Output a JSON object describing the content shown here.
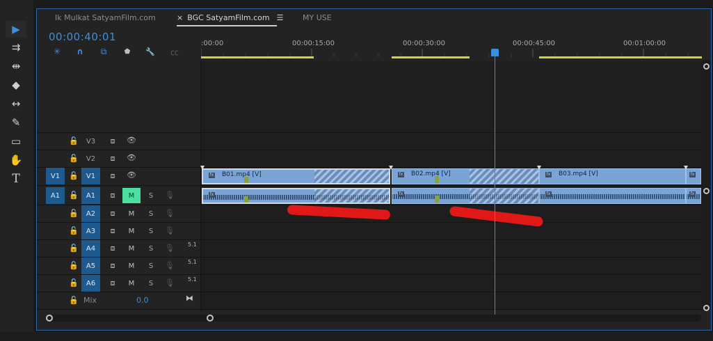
{
  "tabs": [
    {
      "label": "Ik Mulkat SatyamFilm.com",
      "active": false,
      "close": "",
      "menu": ""
    },
    {
      "label": "BGC SatyamFilm.com",
      "active": true,
      "close": "×",
      "menu": "☰"
    },
    {
      "label": "MY USE",
      "active": false,
      "close": "",
      "menu": ""
    }
  ],
  "timecode": "00:00:40:01",
  "ruler": {
    "ticks": [
      ":00:00",
      "00:00:15:00",
      "00:00:30:00",
      "00:00:45:00",
      "00:01:00:00"
    ],
    "playhead_timecode": "00:00:40:01"
  },
  "tools": [
    {
      "name": "selection-tool",
      "icon": "arrow-icon",
      "glyph": "▶",
      "active": true
    },
    {
      "name": "track-select-tool",
      "icon": "track-select-icon",
      "glyph": "⇉",
      "active": false
    },
    {
      "name": "ripple-edit-tool",
      "icon": "ripple-edit-icon",
      "glyph": "⇹",
      "active": false
    },
    {
      "name": "razor-tool",
      "icon": "razor-icon",
      "glyph": "◆",
      "active": false
    },
    {
      "name": "slip-tool",
      "icon": "slip-icon",
      "glyph": "↔",
      "active": false
    },
    {
      "name": "pen-tool",
      "icon": "pen-icon",
      "glyph": "✎",
      "active": false
    },
    {
      "name": "rectangle-tool",
      "icon": "rectangle-icon",
      "glyph": "▭",
      "active": false
    },
    {
      "name": "hand-tool",
      "icon": "hand-icon",
      "glyph": "✋",
      "active": false
    },
    {
      "name": "type-tool",
      "icon": "type-icon",
      "glyph": "T",
      "active": false
    }
  ],
  "timeline_options": [
    {
      "name": "nest-sequence-toggle",
      "icon": "nest-icon",
      "glyph": "✳",
      "color": "#3d8ee0"
    },
    {
      "name": "snap-toggle",
      "icon": "magnet-icon",
      "glyph": "∩",
      "color": "#3d8ee0"
    },
    {
      "name": "linked-selection-toggle",
      "icon": "linked-selection-icon",
      "glyph": "⧉",
      "color": "#3d8ee0"
    },
    {
      "name": "add-marker-button",
      "icon": "marker-icon",
      "glyph": "⬟",
      "color": "#bdbdbd"
    },
    {
      "name": "timeline-settings-button",
      "icon": "wrench-icon",
      "glyph": "🔧",
      "color": "#bdbdbd"
    },
    {
      "name": "captions-toggle",
      "icon": "captions-icon",
      "glyph": "㏄",
      "color": "#5a5a5a"
    }
  ],
  "video_tracks": [
    {
      "label": "V3",
      "source": "",
      "lock": "🔓",
      "sync": "⧈",
      "eye": "👁"
    },
    {
      "label": "V2",
      "source": "",
      "lock": "🔓",
      "sync": "⧈",
      "eye": "👁"
    },
    {
      "label": "V1",
      "source": "V1",
      "lock": "🔓",
      "sync": "⧈",
      "eye": "👁"
    }
  ],
  "audio_tracks": [
    {
      "label": "A1",
      "source": "A1",
      "mute": "M",
      "solo": "S",
      "mute_on": true,
      "s1": ""
    },
    {
      "label": "A2",
      "source": "",
      "mute": "M",
      "solo": "S",
      "mute_on": false,
      "s1": ""
    },
    {
      "label": "A3",
      "source": "",
      "mute": "M",
      "solo": "S",
      "mute_on": false,
      "s1": ""
    },
    {
      "label": "A4",
      "source": "",
      "mute": "M",
      "solo": "S",
      "mute_on": false,
      "s1": "5.1"
    },
    {
      "label": "A5",
      "source": "",
      "mute": "M",
      "solo": "S",
      "mute_on": false,
      "s1": "5.1"
    },
    {
      "label": "A6",
      "source": "",
      "mute": "M",
      "solo": "S",
      "mute_on": false,
      "s1": "5.1"
    }
  ],
  "mix": {
    "label": "Mix",
    "value": "0.0"
  },
  "video_clips": [
    {
      "name": "B01.mp4 [V]",
      "fx": "fx"
    },
    {
      "name": "B02.mp4 [V]",
      "fx": "fx"
    },
    {
      "name": "B03.mp4 [V]",
      "fx": "fx"
    },
    {
      "name": "",
      "fx": "fx"
    }
  ],
  "audio_clips": [
    {
      "fx": "fx"
    },
    {
      "fx": "fx"
    },
    {
      "fx": "fx"
    },
    {
      "fx": "fx"
    }
  ],
  "colors": {
    "accent": "#3d8ee0",
    "clip": "#7aa3d6",
    "mute_on": "#4be0a0",
    "inout_bar": "#d6d23a",
    "annotation": "#e01818"
  }
}
